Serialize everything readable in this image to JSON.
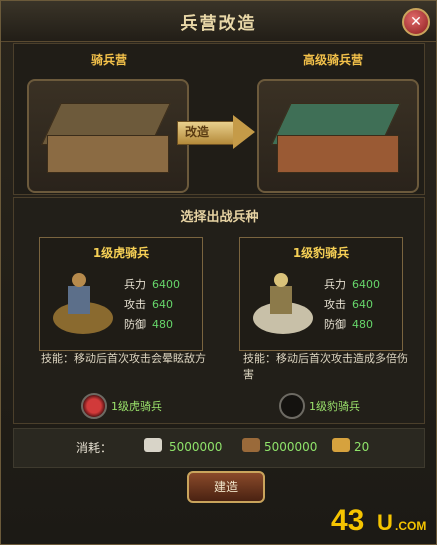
{
  "window": {
    "title": "兵营改造"
  },
  "top": {
    "left_label": "骑兵营",
    "right_label": "高级骑兵营",
    "arrow_label": "改造"
  },
  "section": {
    "title": "选择出战兵种"
  },
  "units": [
    {
      "name": "1级虎骑兵",
      "stats": [
        {
          "label": "兵力",
          "value": "6400"
        },
        {
          "label": "攻击",
          "value": "640"
        },
        {
          "label": "防御",
          "value": "480"
        }
      ],
      "skill": "技能：移动后首次攻击会晕眩敌方",
      "radio_label": "1级虎骑兵",
      "selected": true
    },
    {
      "name": "1级豹骑兵",
      "stats": [
        {
          "label": "兵力",
          "value": "6400"
        },
        {
          "label": "攻击",
          "value": "640"
        },
        {
          "label": "防御",
          "value": "480"
        }
      ],
      "skill": "技能：移动后首次攻击造成多倍伤害",
      "radio_label": "1级豹骑兵",
      "selected": false
    }
  ],
  "cost": {
    "label": "消耗：",
    "items": [
      {
        "icon": "silver-icon",
        "value": "5000000"
      },
      {
        "icon": "wood-icon",
        "value": "5000000"
      },
      {
        "icon": "order-icon",
        "value": "20"
      }
    ]
  },
  "build_button": "建造",
  "watermark": "43U.COM",
  "colors": {
    "accent_gold": "#f5cf55",
    "value_green": "#66d66a"
  }
}
